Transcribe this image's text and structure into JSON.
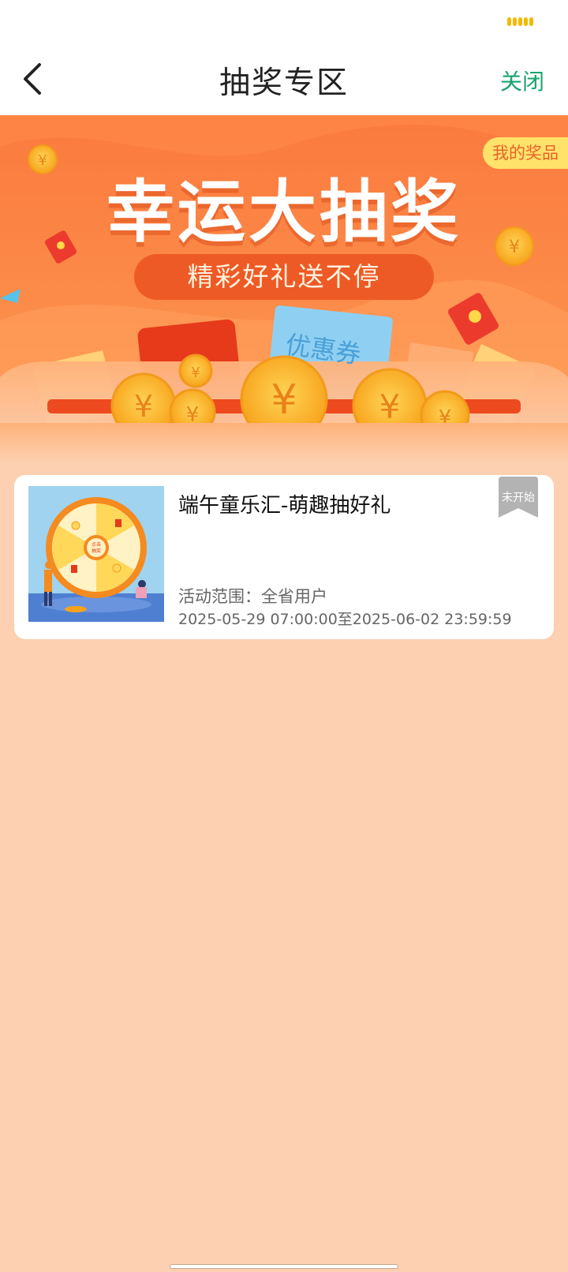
{
  "nav": {
    "title": "抽奖专区",
    "close_label": "关闭",
    "back_icon": "chevron-left-icon"
  },
  "banner": {
    "title": "幸运大抽奖",
    "subtitle": "精彩好礼送不停",
    "my_prizes_label": "我的奖品",
    "coupon_label": "优惠券"
  },
  "activities": [
    {
      "title": "端午童乐汇-萌趣抽好礼",
      "status": "未开始",
      "scope": "活动范围：全省用户",
      "time": "2025-05-29 07:00:00至2025-06-02 23:59:59",
      "thumb_label_top": "点击",
      "thumb_label_bottom": "抽奖"
    }
  ],
  "colors": {
    "accent_green": "#1aa36e",
    "banner_orange": "#fb7a3e",
    "page_bg": "#fcd0b1",
    "status_tag": "#b3b3b3"
  }
}
